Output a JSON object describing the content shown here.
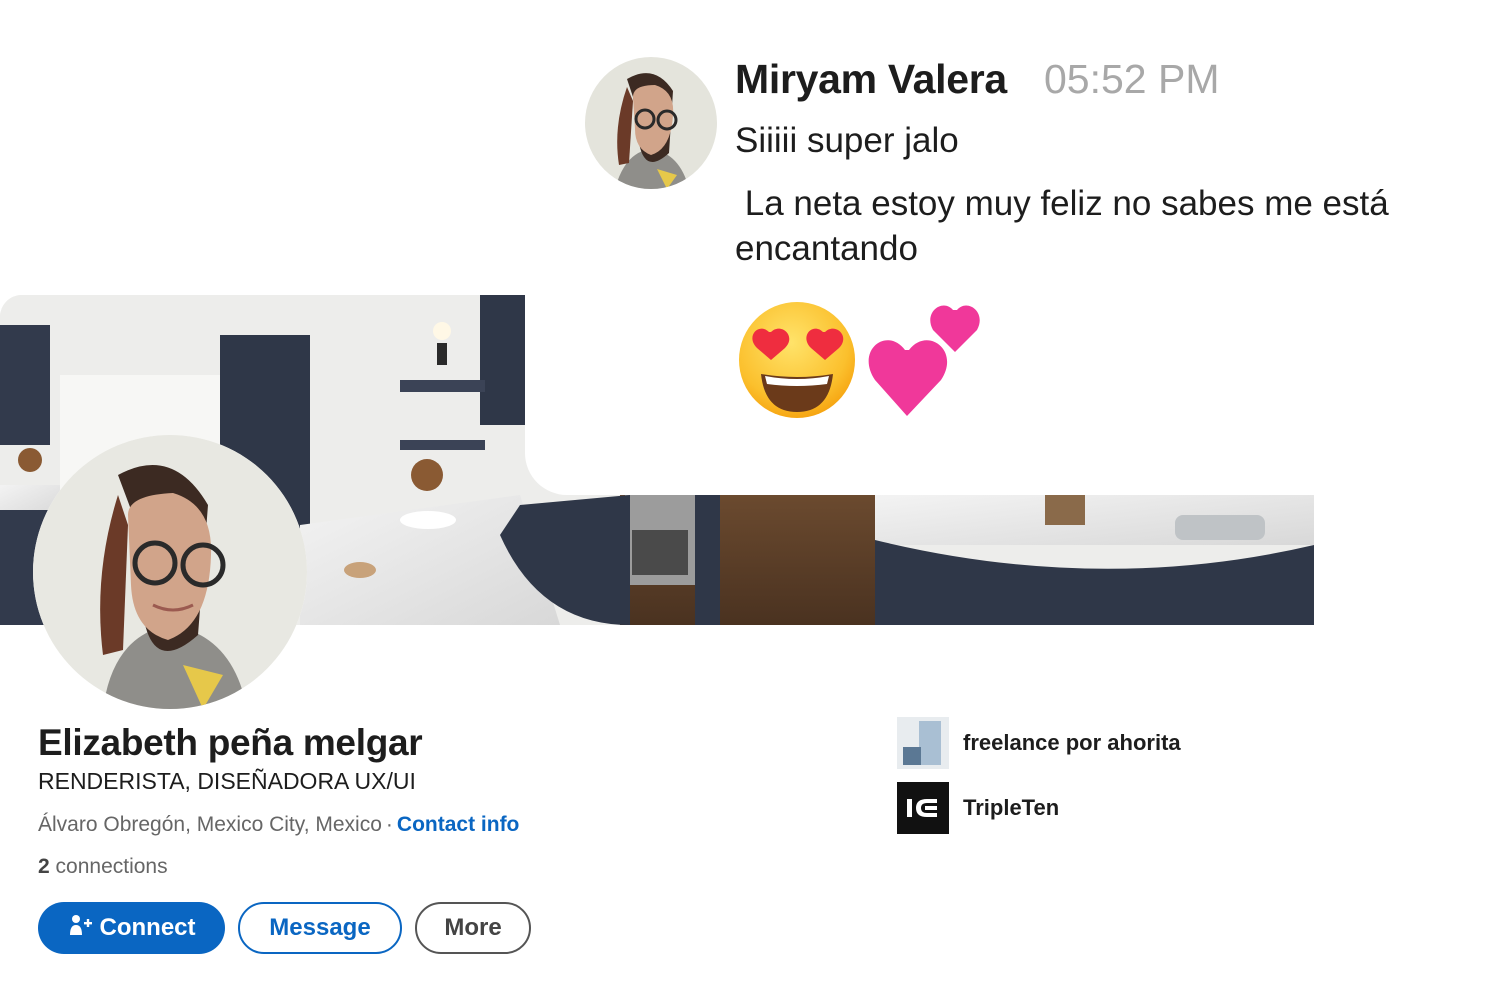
{
  "chat": {
    "sender": "Miryam Valera",
    "time": "05:52 PM",
    "lines": [
      "Siiiii super jalo",
      " La neta estoy muy feliz no sabes me está encantando"
    ],
    "emojis": [
      "smiling-face-with-heart-eyes-icon",
      "two-hearts-icon"
    ]
  },
  "profile": {
    "name": "Elizabeth peña melgar",
    "headline": "RENDERISTA, DISEÑADORA UX/UI",
    "location": "Álvaro Obregón, Mexico City, Mexico",
    "separator": "·",
    "contact_link": "Contact info",
    "connections_count": "2",
    "connections_label": "connections",
    "buttons": {
      "connect": "Connect",
      "message": "Message",
      "more": "More"
    },
    "experience": [
      {
        "label": "freelance por ahorita",
        "logo": "company-placeholder-icon"
      },
      {
        "label": "TripleTen",
        "logo": "tripleten-logo-icon"
      }
    ]
  },
  "colors": {
    "accent": "#0a66c2",
    "muted_text": "#666666",
    "time_text": "#a8a8a8"
  }
}
